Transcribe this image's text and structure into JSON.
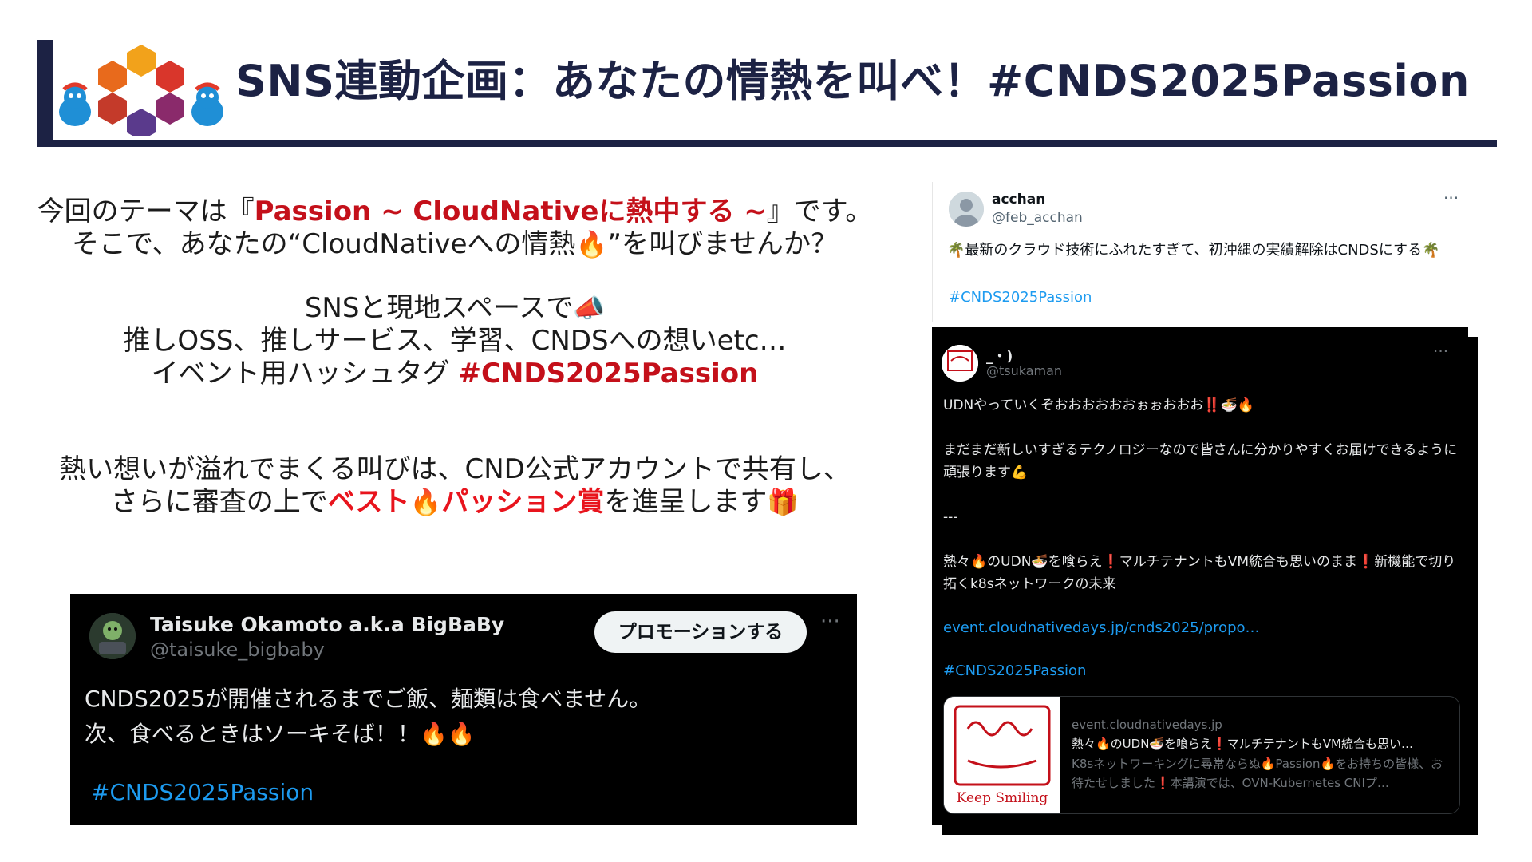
{
  "slide": {
    "title": "SNS連動企画：あなたの情熱を叫べ！#CNDS2025Passion"
  },
  "intro": {
    "l1_a": "今回のテーマは『",
    "l1_b": "Passion ~ CloudNativeに熱中する ~",
    "l1_c": "』です。",
    "l2_a": "そこで、あなたの“CloudNativeへの情熱",
    "l2_emoji": "🔥",
    "l2_b": "”を叫びませんか？"
  },
  "sns": {
    "l1_a": "SNSと現地スペースで",
    "l1_emoji": "📣",
    "l2": "推しOSS、推しサービス、学習、CNDSへの想いetc…",
    "l3_a": "イベント用ハッシュタグ ",
    "l3_tag": "#CNDS2025Passion"
  },
  "award": {
    "l1": "熱い想いが溢れでまくる叫びは、CND公式アカウントで共有し、",
    "l2_a": "さらに審査の上で",
    "l2_b": "ベスト",
    "l2_emoji": "🔥",
    "l2_c": "パッション賞",
    "l2_d": "を進呈します",
    "l2_gift": "🎁"
  },
  "tweet_bigbaby": {
    "name": "Taisuke Okamoto a.k.a BigBaBy",
    "handle": "@taisuke_bigbaby",
    "promote_label": "プロモーションする",
    "more": "···",
    "line1": "CNDS2025が開催されるまでご飯、麺類は食べません。",
    "line2": "次、食べるときはソーキそば！！🔥🔥",
    "hashtag": "#CNDS2025Passion"
  },
  "tweet_acchan": {
    "name": "acchan",
    "handle": "@feb_acchan",
    "more": "···",
    "body": "🌴最新のクラウド技術にふれたすぎて、初沖縄の実績解除はCNDSにする🌴",
    "hashtag": "#CNDS2025Passion"
  },
  "tweet_tsukaman": {
    "name": "_・)",
    "handle": "@tsukaman",
    "more": "···",
    "p1": "UDNやっていくぞおおおおおおぉぉおおお‼️🍜🔥",
    "p2": "まだまだ新しいすぎるテクノロジーなので皆さんに分かりやすくお届けできるように頑張ります💪",
    "p3": "---",
    "p4": "熱々🔥のUDN🍜を喰らえ❗️マルチテナントもVM統合も思いのまま❗️新機能で切り拓くk8sネットワークの未来",
    "link": "event.cloudnativedays.jp/cnds2025/propo…",
    "hashtag": "#CNDS2025Passion",
    "card": {
      "domain": "event.cloudnativedays.jp",
      "title": "熱々🔥のUDN🍜を喰らえ❗️マルチテナントもVM統合も思い…",
      "desc": "K8sネットワーキングに尋常ならぬ🔥Passion🔥をお持ちの皆様、お待たせしました❗️本講演では、OVN-Kubernetes CNIプ…",
      "thumb_text": "Keep Smiling"
    }
  },
  "colors": {
    "navy": "#1c2244",
    "accent_red": "#c4101a",
    "link_blue": "#1d9bf0"
  }
}
